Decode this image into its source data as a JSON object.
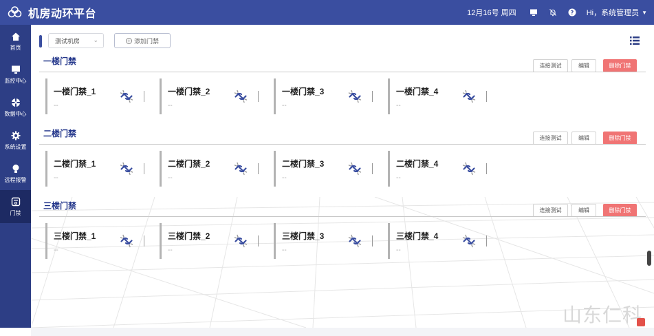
{
  "app": {
    "title": "机房动环平台"
  },
  "header": {
    "date": "12月16号 周四",
    "greeting": "Hi，系统管理员",
    "icons": [
      "monitor-icon",
      "bell-off-icon",
      "help-icon"
    ]
  },
  "sidebar": {
    "items": [
      {
        "label": "首页",
        "icon": "home-icon",
        "active": false
      },
      {
        "label": "监控中心",
        "icon": "monitor-icon",
        "active": false
      },
      {
        "label": "数据中心",
        "icon": "data-icon",
        "active": false
      },
      {
        "label": "系统设置",
        "icon": "gear-icon",
        "active": false
      },
      {
        "label": "远程报警",
        "icon": "alarm-bulb-icon",
        "active": false
      },
      {
        "label": "门禁",
        "icon": "door-access-icon",
        "active": true
      }
    ]
  },
  "toolbar": {
    "room_select": "测试机房",
    "add_label": "添加门禁"
  },
  "buttons": {
    "test": "连接测试",
    "edit": "编辑",
    "delete": "删除门禁"
  },
  "sections": [
    {
      "title": "一楼门禁",
      "doors": [
        {
          "name": "一楼门禁_1",
          "status": "--"
        },
        {
          "name": "一楼门禁_2",
          "status": "--"
        },
        {
          "name": "一楼门禁_3",
          "status": "--"
        },
        {
          "name": "一楼门禁_4",
          "status": "--"
        }
      ]
    },
    {
      "title": "二楼门禁",
      "doors": [
        {
          "name": "二楼门禁_1",
          "status": "--"
        },
        {
          "name": "二楼门禁_2",
          "status": "--"
        },
        {
          "name": "二楼门禁_3",
          "status": "--"
        },
        {
          "name": "二楼门禁_4",
          "status": "--"
        }
      ]
    },
    {
      "title": "三楼门禁",
      "doors": [
        {
          "name": "三楼门禁_1",
          "status": "--"
        },
        {
          "name": "三楼门禁_2",
          "status": "--"
        },
        {
          "name": "三楼门禁_3",
          "status": "--"
        },
        {
          "name": "三楼门禁_4",
          "status": "--"
        }
      ]
    }
  ],
  "watermark": "山东仁科",
  "colors": {
    "header": "#3a4ea0",
    "sidebar": "#2d3e85",
    "sidebar_active": "#1d2a63",
    "accent_text": "#22358a",
    "delete": "#f07474",
    "link_icon": "#3a4ea0"
  }
}
